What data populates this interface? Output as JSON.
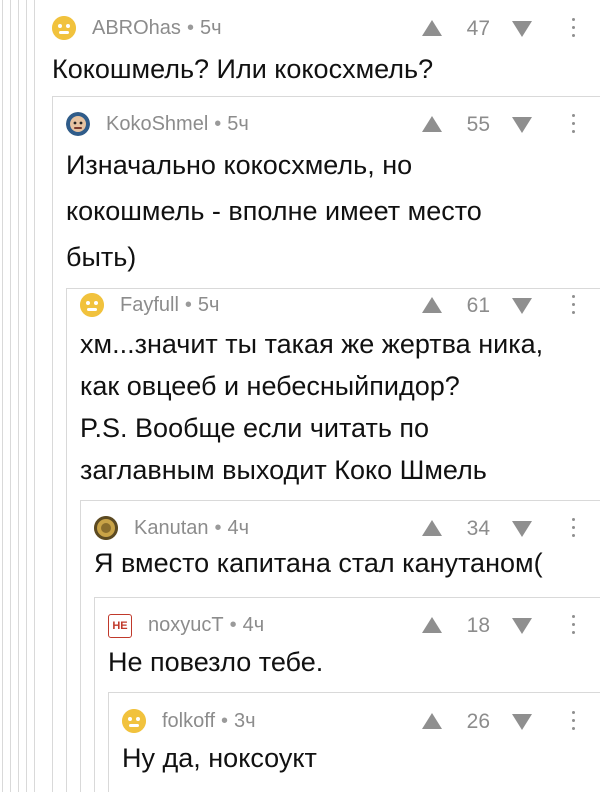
{
  "comments": [
    {
      "user": "ABROhas",
      "time": "5ч",
      "rating": "47",
      "avatar_icon": "default-face-icon",
      "lines": [
        "Кокошмель? Или кокосхмель?"
      ]
    },
    {
      "user": "KokoShmel",
      "time": "5ч",
      "rating": "55",
      "avatar_icon": "person-photo-icon",
      "lines": [
        "Изначально кокосхмель, но",
        "кокошмель - вполне имеет место",
        "быть)"
      ]
    },
    {
      "user": "Fayfull",
      "time": "5ч",
      "rating": "61",
      "avatar_icon": "default-face-icon",
      "lines": [
        "хм...значит ты такая же жертва ника,",
        "как овцееб и небесныйпидор?",
        "P.S. Вообще если читать по",
        "заглавным выходит Коко Шмель"
      ]
    },
    {
      "user": "Kanutan",
      "time": "4ч",
      "rating": "34",
      "avatar_icon": "gold-coin-icon",
      "lines": [
        "Я вместо капитана стал канутаном("
      ]
    },
    {
      "user": "noxyucT",
      "time": "4ч",
      "rating": "18",
      "avatar_icon": "badge-icon",
      "avatar_text": "НЕ",
      "lines": [
        "Не повезло тебе."
      ]
    },
    {
      "user": "folkoff",
      "time": "3ч",
      "rating": "26",
      "avatar_icon": "default-face-icon",
      "lines": [
        "Ну да, ноксоукт"
      ]
    }
  ],
  "colors": {
    "meta_text": "#8c8c8c",
    "body_text": "#111111",
    "thread_line": "#d9d9d9",
    "avatar_default": "#f1c23d"
  }
}
